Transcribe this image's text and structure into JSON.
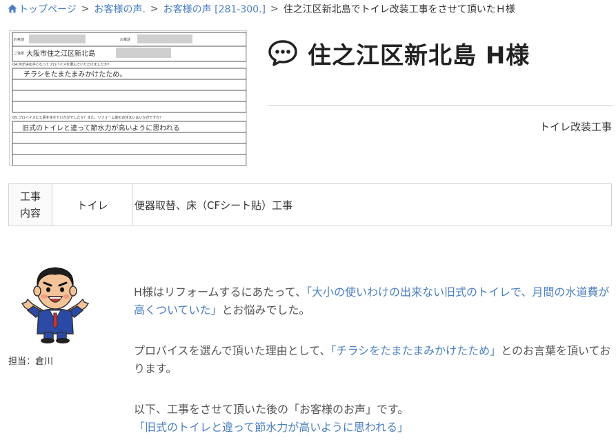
{
  "breadcrumb": {
    "home": "トップページ",
    "level1": "お客様の声.",
    "level2": "お客様の声 [281-300.]",
    "current": "住之江区新北島でトイレ改装工事をさせて頂いたＨ様",
    "separator": ">"
  },
  "survey": {
    "name_label": "お名前",
    "tel_label": "お電話",
    "address_label": "ご住所",
    "address_hand": "大阪市住之江区新北島",
    "q4_label": "Q4.何が決め手となってプロバイスを選んでいただけましたか？",
    "q4_answer": "チラシをたまたまみかけたため。",
    "q5_label": "Q5.プロバイスに工事を任せていかがでしたか？また、リフォーム後のお住まいはいかがですか？",
    "q5_answer": "旧式のトイレと違って節水力が高いように思われる"
  },
  "header": {
    "title": "住之江区新北島 H様",
    "work_type": "トイレ改装工事"
  },
  "table": {
    "header": "工事\n内容",
    "header_line1": "工事",
    "header_line2": "内容",
    "category": "トイレ",
    "description": "便器取替、床（CFシート貼）工事"
  },
  "staff": {
    "label": "担当：倉川"
  },
  "body": {
    "p1_pre": "H様はリフォームするにあたって、",
    "p1_quote": "「大小の使いわけの出来ない旧式のトイレで、月間の水道費が高くついていた」",
    "p1_post": "とお悩みでした。",
    "p2_pre": "プロバイスを選んで頂いた理由として、",
    "p2_quote": "「チラシをたまたまみかけたため」",
    "p2_post": "とのお言葉を頂いております。",
    "p3_line1": "以下、工事をさせて頂いた後の「お客様のお声」です。",
    "p3_quote": "「旧式のトイレと違って節水力が高いように思われる」"
  },
  "colors": {
    "link": "#4a7fc1",
    "text": "#333333",
    "body_text": "#555555",
    "highlight": "#4a7fc1",
    "border": "#d4d4d4"
  }
}
